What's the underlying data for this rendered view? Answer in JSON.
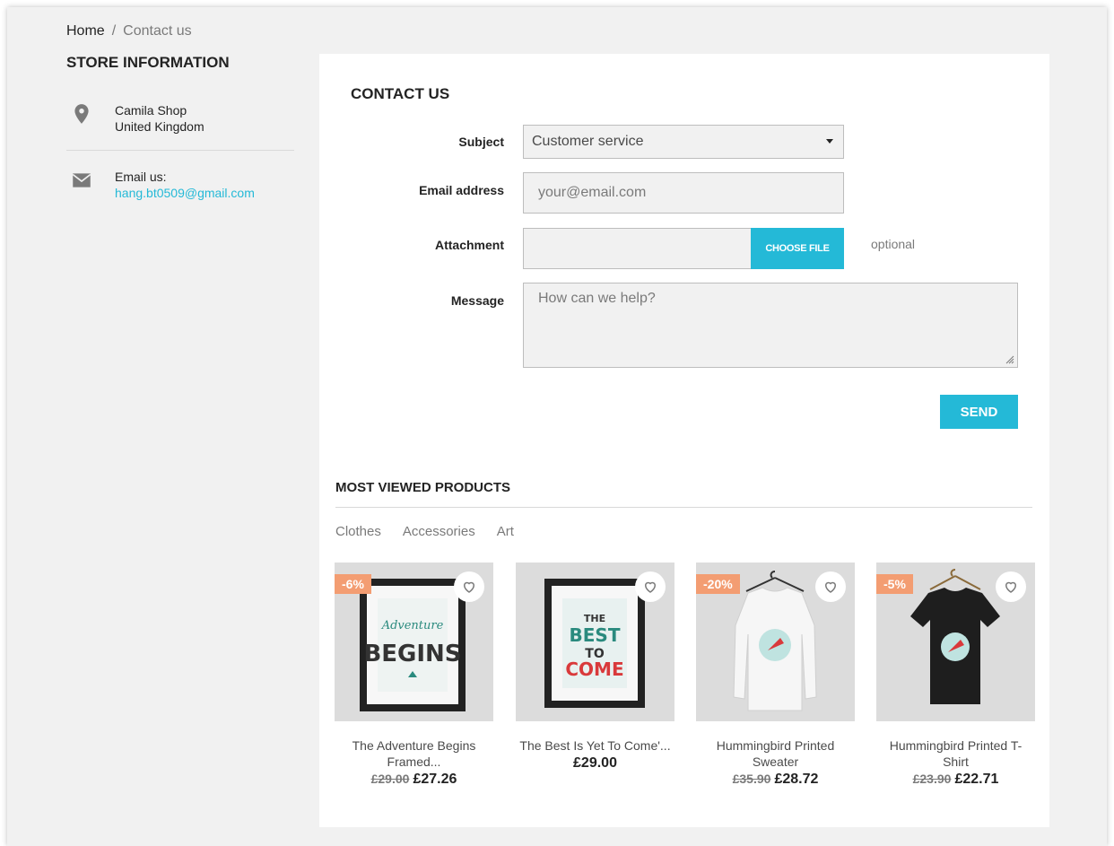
{
  "breadcrumb": {
    "home": "Home",
    "separator": "/",
    "current": "Contact us"
  },
  "store": {
    "title": "STORE INFORMATION",
    "shop_name": "Camila Shop",
    "country": "United Kingdom",
    "email_label": "Email us:",
    "email": "hang.bt0509@gmail.com",
    "address_icon": "map-marker-icon",
    "email_icon": "envelope-icon"
  },
  "contact": {
    "title": "CONTACT US",
    "subject_label": "Subject",
    "subject_value": "Customer service",
    "email_label": "Email address",
    "email_placeholder": "your@email.com",
    "attachment_label": "Attachment",
    "choose_file": "CHOOSE FILE",
    "optional": "optional",
    "message_label": "Message",
    "message_placeholder": "How can we help?",
    "send": "SEND"
  },
  "most_viewed": {
    "title": "MOST VIEWED PRODUCTS",
    "tabs": [
      "Clothes",
      "Accessories",
      "Art"
    ],
    "products": [
      {
        "badge": "-6%",
        "name": "The Adventure Begins Framed...",
        "old_price": "£29.00",
        "price": "£27.26"
      },
      {
        "badge": "",
        "name": "The Best Is Yet To Come'...",
        "old_price": "",
        "price": "£29.00"
      },
      {
        "badge": "-20%",
        "name": "Hummingbird Printed Sweater",
        "old_price": "£35.90",
        "price": "£28.72"
      },
      {
        "badge": "-5%",
        "name": "Hummingbird Printed T-Shirt",
        "old_price": "£23.90",
        "price": "£22.71"
      }
    ]
  },
  "colors": {
    "accent": "#24b9d7",
    "badge": "#f39d72",
    "background": "#f1f1f1"
  }
}
